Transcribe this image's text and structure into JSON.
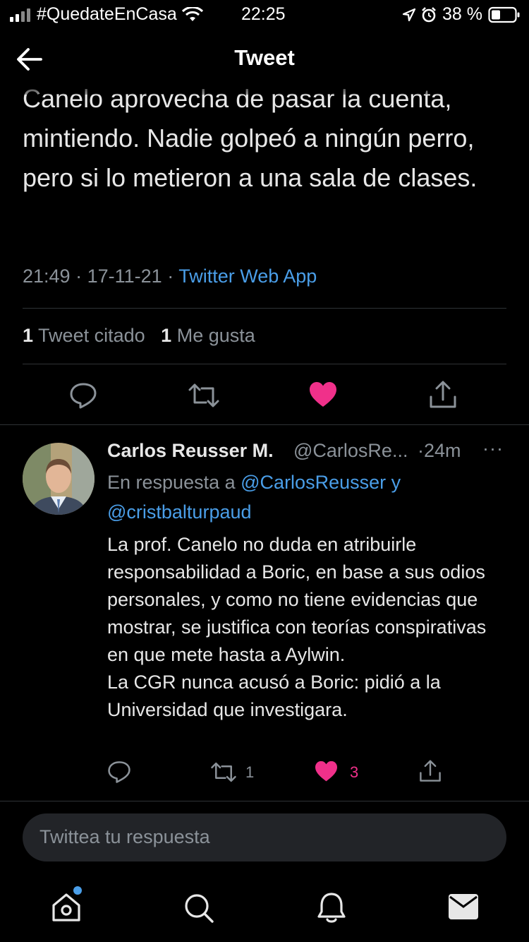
{
  "status_bar": {
    "carrier": "#QuedateEnCasa",
    "time": "22:25",
    "battery_percent": "38 %"
  },
  "header": {
    "title": "Tweet"
  },
  "tweet": {
    "text": "Canelo aprovecha de pasar la cuenta, mintiendo. Nadie golpeó a ningún perro, pero si lo metieron a una sala de clases.",
    "time": "21:49",
    "date": "17-11-21",
    "source": "Twitter Web App",
    "quote_count": "1",
    "quote_label": "Tweet citado",
    "like_count": "1",
    "like_label": "Me gusta"
  },
  "reply": {
    "name": "Carlos Reusser M.",
    "handle": "@CarlosRe...",
    "time": "·24m",
    "more": "···",
    "in_reply_prefix": "En respuesta a",
    "mention1": "@CarlosReusser",
    "conj": "y",
    "mention2": "@cristbalturpaud",
    "text": "La prof. Canelo no duda en atribuirle responsabilidad a Boric, en base a sus odios personales, y como no tiene evidencias que mostrar, se justifica con teorías conspirativas en que mete hasta a Aylwin.\nLa CGR nunca acusó a Boric: pidió a la Universidad que investigara.",
    "retweet_count": "1",
    "like_count": "3"
  },
  "compose": {
    "placeholder": "Twittea tu respuesta"
  },
  "icons": [
    "back-arrow-icon",
    "reply-icon",
    "retweet-icon",
    "heart-icon",
    "share-icon",
    "home-icon",
    "search-icon",
    "bell-icon",
    "mail-icon"
  ],
  "colors": {
    "accent": "#4a9ee8",
    "like": "#f0308a",
    "background": "#000000"
  }
}
